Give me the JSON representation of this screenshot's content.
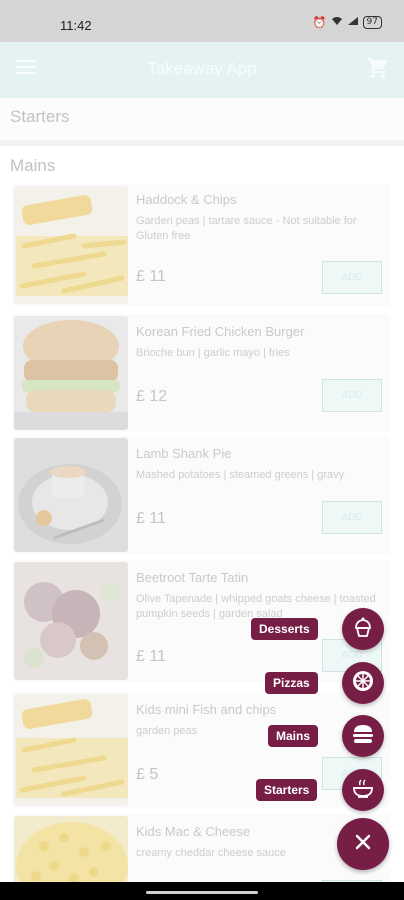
{
  "status_bar": {
    "time": "11:42",
    "icons": [
      "alarm-icon",
      "vibrate-icon",
      "wifi-icon",
      "volte-icon",
      "signal-icon"
    ],
    "battery": "97"
  },
  "app_bar": {
    "title": "Takeaway App",
    "menu_icon": "menu-icon",
    "cart_icon": "cart-icon"
  },
  "sections": {
    "starters": "Starters",
    "mains": "Mains"
  },
  "items": [
    {
      "name": "Haddock & Chips",
      "description": "Garden peas | tartare sauce - Not suitable for Gluten free",
      "price": "£ 11",
      "button": "ADD"
    },
    {
      "name": "Korean Fried Chicken Burger",
      "description": "Brioche bun | garlic mayo | fries",
      "price": "£ 12",
      "button": "ADD"
    },
    {
      "name": "Lamb Shank Pie",
      "description": "Mashed potatoes | steamed greens | gravy",
      "price": "£ 11",
      "button": "ADD"
    },
    {
      "name": "Beetroot Tarte Tatin",
      "description": "Olive Tapenade | whipped goats cheese | toasted pumpkin seeds | garden salad",
      "price": "£ 11",
      "button": "ADD"
    },
    {
      "name": "Kids mini Fish and chips",
      "description": "garden peas",
      "price": "£ 5",
      "button": "ADD"
    },
    {
      "name": "Kids Mac & Cheese",
      "description": "creamy cheddar cheese sauce",
      "price": "",
      "button": ""
    }
  ],
  "fab_menu": {
    "desserts": "Desserts",
    "pizzas": "Pizzas",
    "mains": "Mains",
    "starters": "Starters",
    "close_icon": "close-icon"
  },
  "colors": {
    "accent": "#761e45",
    "app_bar": "#e4f3f2",
    "status_bar": "#d5d5d5"
  }
}
